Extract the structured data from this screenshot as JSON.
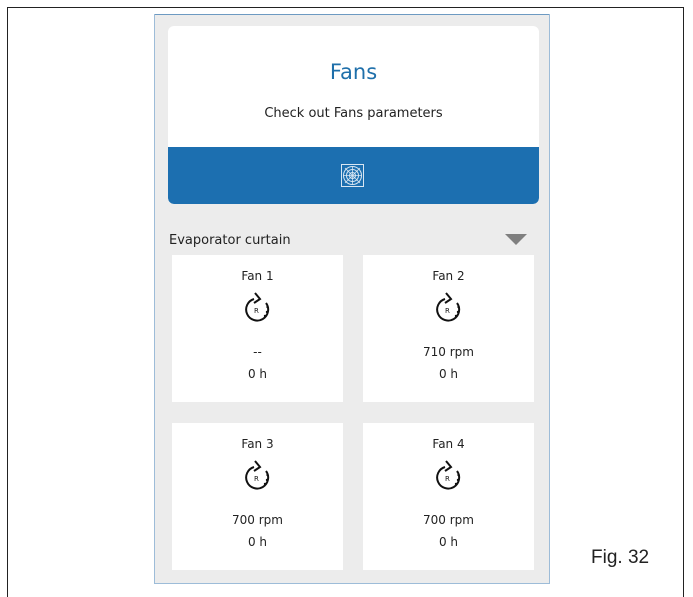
{
  "header": {
    "title": "Fans",
    "subtitle": "Check out Fans parameters",
    "icon": "fan-grill-icon"
  },
  "section": {
    "label": "Evaporator curtain",
    "toggle_icon": "triangle-down-icon"
  },
  "fans": [
    {
      "name": "Fan 1",
      "speed": "--",
      "hours": "0 h",
      "icon": "rotation-hours-icon"
    },
    {
      "name": "Fan 2",
      "speed": "710 rpm",
      "hours": "0 h",
      "icon": "rotation-hours-icon"
    },
    {
      "name": "Fan 3",
      "speed": "700 rpm",
      "hours": "0 h",
      "icon": "rotation-hours-icon"
    },
    {
      "name": "Fan 4",
      "speed": "700 rpm",
      "hours": "0 h",
      "icon": "rotation-hours-icon"
    }
  ],
  "caption": "Fig. 32",
  "colors": {
    "accent": "#1c6fb0",
    "title": "#1e6faa",
    "background": "#ececec"
  }
}
